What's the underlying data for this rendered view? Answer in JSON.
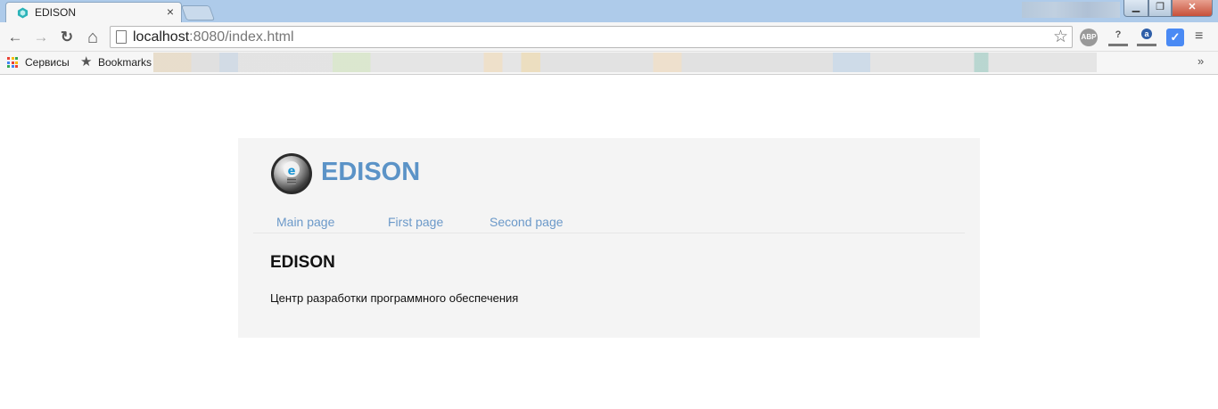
{
  "browser": {
    "tab_title": "EDISON",
    "tab_close": "×",
    "url_host": "localhost",
    "url_rest": ":8080/index.html",
    "back_icon": "←",
    "forward_icon": "→",
    "reload_icon": "↻",
    "home_icon": "⌂",
    "star_icon": "☆",
    "ext_abp": "ABP",
    "ext_q": "?",
    "ext_a": "a",
    "ext_check": "✓",
    "menu_icon": "≡",
    "win_min": "▁",
    "win_max": "❐",
    "win_close": "✕"
  },
  "bookmarks": {
    "services_label": "Сервисы",
    "bookmarks_label": "Bookmarks",
    "more_icon": "»"
  },
  "site": {
    "brand": "EDISON",
    "nav": [
      {
        "label": "Main page"
      },
      {
        "label": "First page"
      },
      {
        "label": "Second page"
      }
    ],
    "heading": "EDISON",
    "text": "Центр разработки программного обеспечения",
    "accent_color": "#5b93c7"
  }
}
